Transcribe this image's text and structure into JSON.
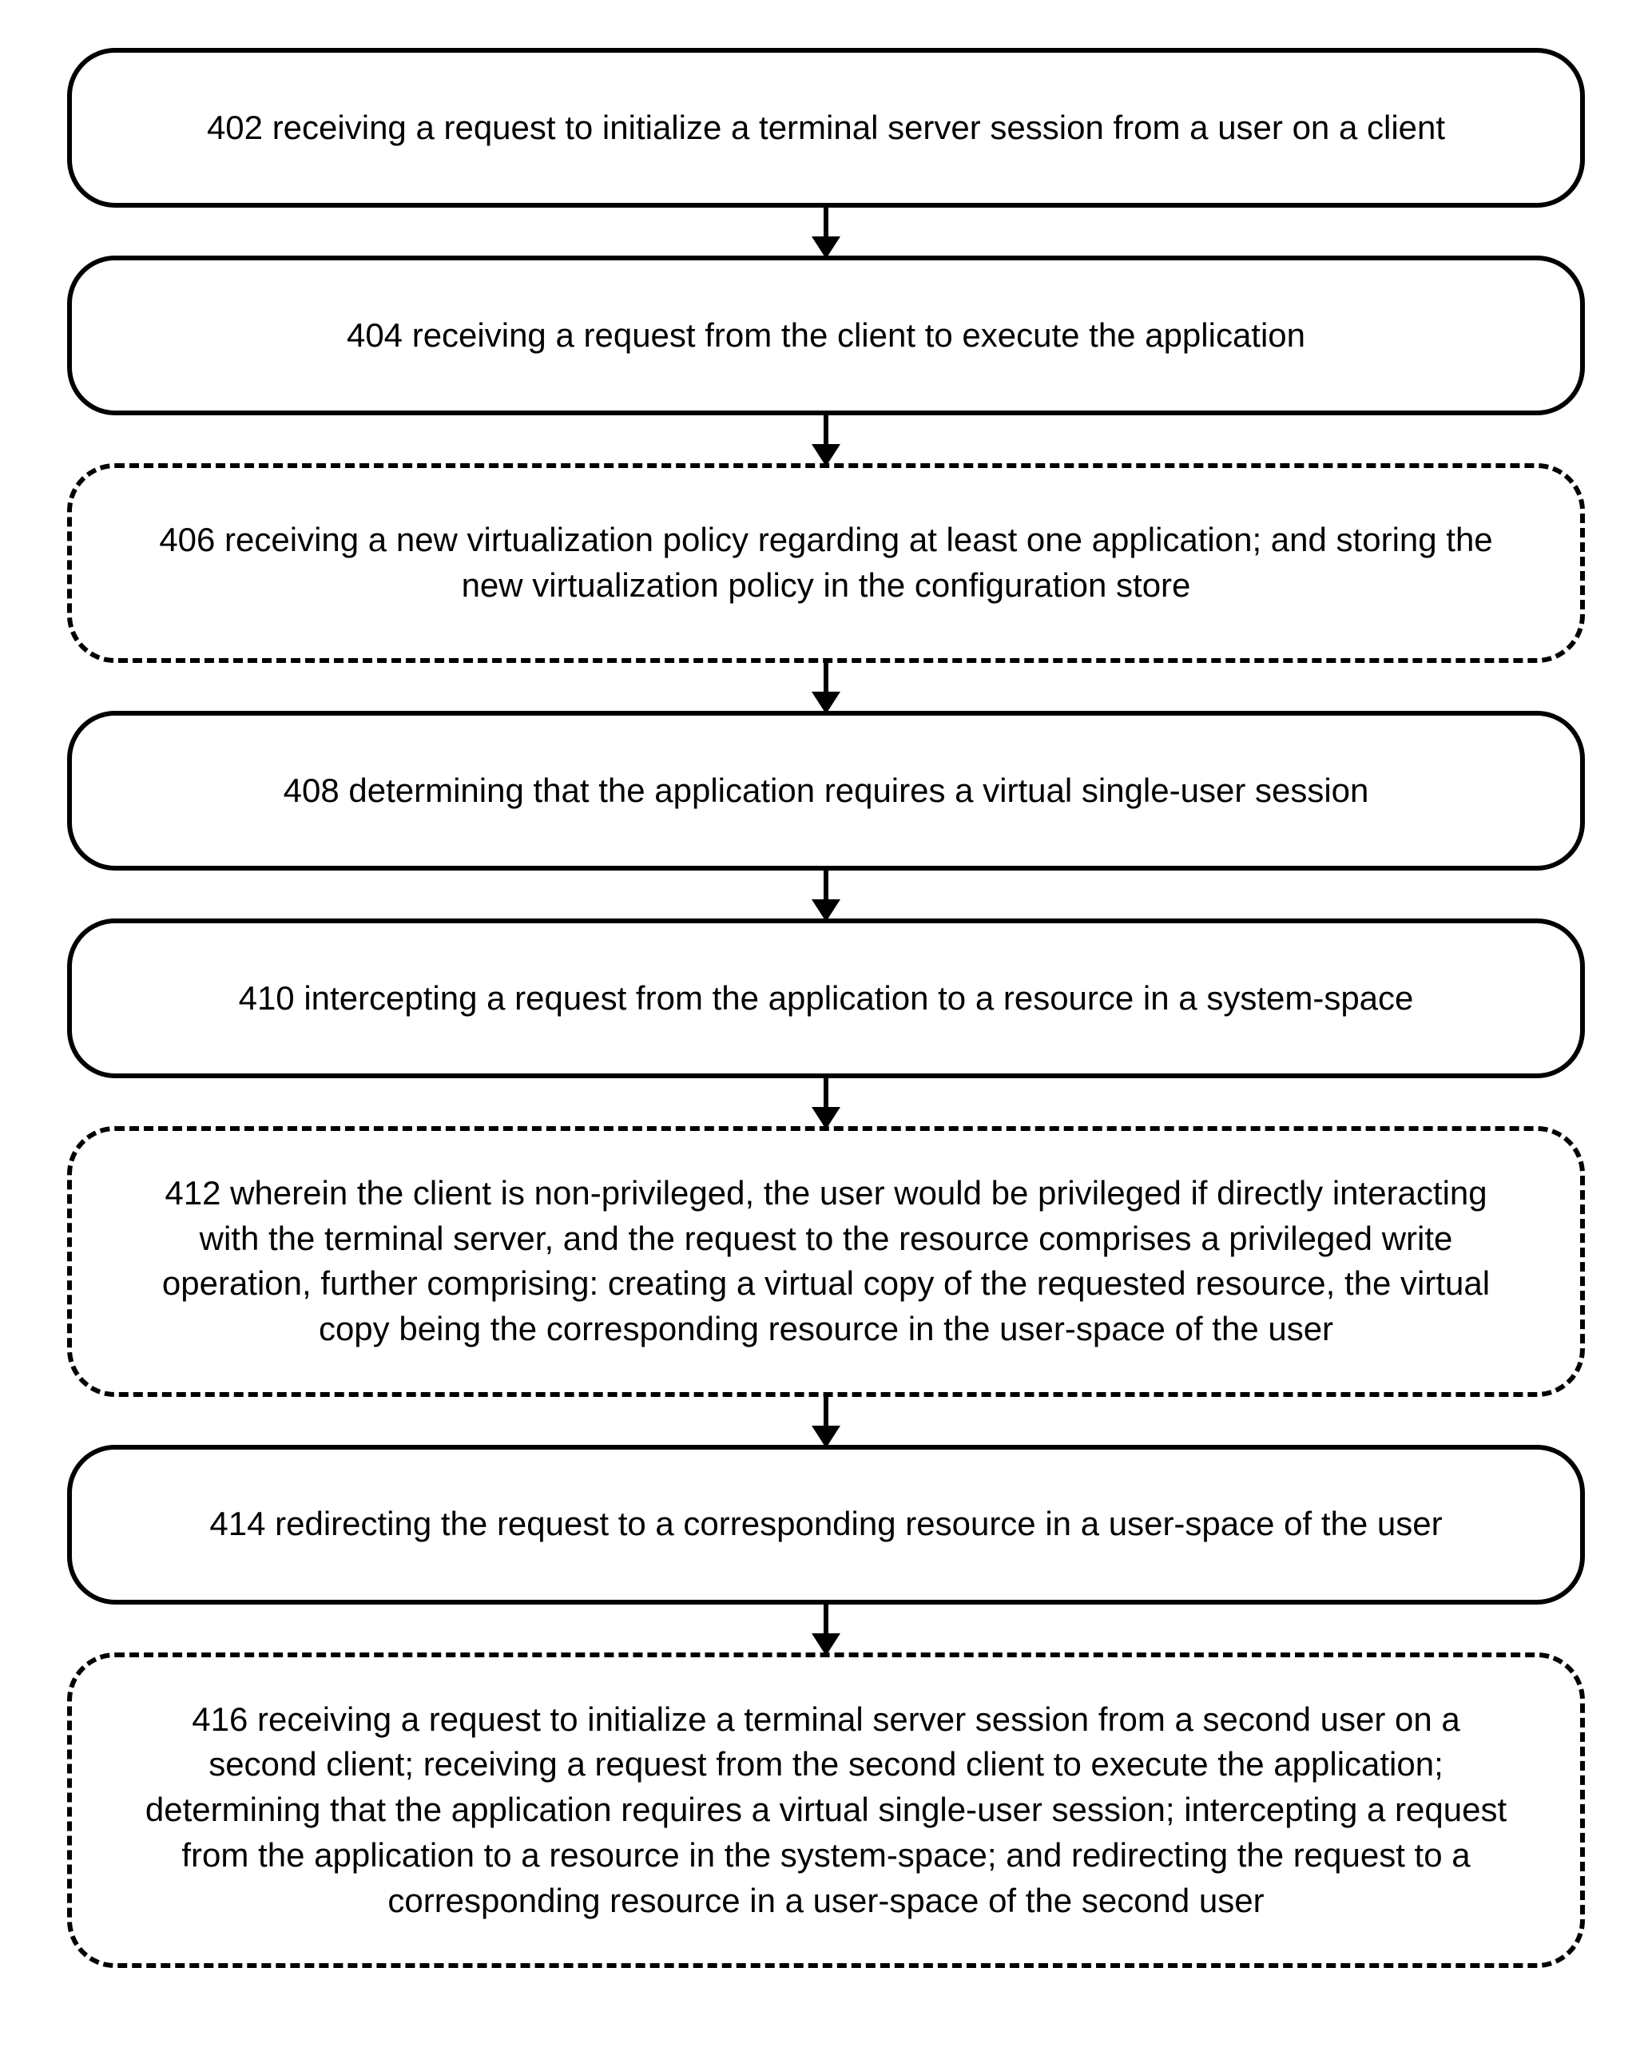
{
  "flow": {
    "nodes": [
      {
        "id": "402",
        "style": "solid",
        "size": "h1line",
        "text": "402 receiving a request to initialize a terminal server session from a user on a client"
      },
      {
        "id": "404",
        "style": "solid",
        "size": "h1line",
        "text": "404 receiving a request from the client to execute the application"
      },
      {
        "id": "406",
        "style": "dashed",
        "size": "h2line",
        "text": "406 receiving a new virtualization policy regarding at least one application; and storing the new virtualization policy in the configuration store"
      },
      {
        "id": "408",
        "style": "solid",
        "size": "h1line",
        "text": "408 determining that the application requires a virtual single-user session"
      },
      {
        "id": "410",
        "style": "solid",
        "size": "h1line",
        "text": "410 intercepting a request from the application to a resource in a system-space"
      },
      {
        "id": "412",
        "style": "dashed",
        "size": "h4line",
        "text": "412 wherein the client is non-privileged, the user would be privileged if directly interacting with the terminal server, and the request to the resource comprises a privileged write operation, further comprising: creating a virtual copy of the requested resource, the virtual copy being the corresponding resource in the user-space of the user"
      },
      {
        "id": "414",
        "style": "solid",
        "size": "h1line",
        "text": "414 redirecting the request to a corresponding resource in a user-space of the user"
      },
      {
        "id": "416",
        "style": "dashed",
        "size": "h5line",
        "text": "416 receiving a request to initialize a terminal server session from a second user on a second client; receiving a request from the second client to execute the application; determining that the application requires a virtual single-user session; intercepting a request from the application to a resource in the system-space; and redirecting the request to a corresponding resource in a user-space of the second user"
      }
    ]
  }
}
